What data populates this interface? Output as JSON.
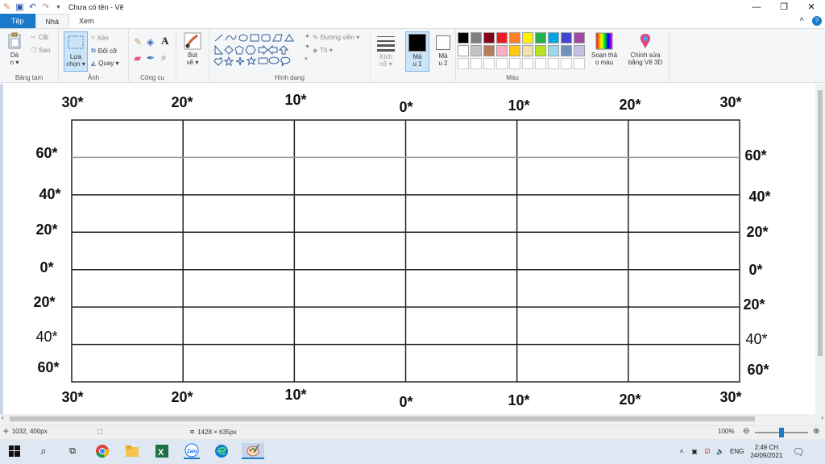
{
  "window": {
    "title": "Chưa có tên - Vẽ",
    "min_glyph": "—",
    "max_glyph": "❐",
    "close_glyph": "✕"
  },
  "tabs": [
    {
      "label": "Tệp"
    },
    {
      "label": "Nhà"
    },
    {
      "label": "Xem"
    }
  ],
  "ribbon": {
    "clipboard": {
      "paste_label": "Dá",
      "paste_label2": "n ▾",
      "cut_label": "Cắt",
      "copy_label": "Sao",
      "group_label": "Bảng tạm"
    },
    "image": {
      "select_label": "Lựa",
      "select_label2": "chọn ▾",
      "crop_label": "Xén",
      "resize_label": "Đổi cỡ",
      "rotate_label": "Quay ▾",
      "group_label": "Ảnh"
    },
    "tools": {
      "group_label": "Công cụ"
    },
    "brush": {
      "label": "Bút",
      "label2": "vẽ ▾"
    },
    "shapes": {
      "outline_label": "Đường viền ▾",
      "fill_label": "Tô ▾",
      "group_label": "Hình dạng"
    },
    "size": {
      "label": "Kích",
      "label2": "cỡ ▾"
    },
    "color1": {
      "label": "Mà",
      "label2": "u 1",
      "value": "#000000"
    },
    "color2": {
      "label": "Mà",
      "label2": "u 2",
      "value": "#ffffff"
    },
    "palette": {
      "colors": [
        "#000000",
        "#7f7f7f",
        "#880015",
        "#ed1c24",
        "#ff7f27",
        "#fff200",
        "#22b14c",
        "#00a2e8",
        "#3f48cc",
        "#a349a4",
        "#ffffff",
        "#c3c3c3",
        "#b97a57",
        "#ffaec9",
        "#ffc90e",
        "#efe4b0",
        "#b5e61d",
        "#99d9ea",
        "#7092be",
        "#c8bfe7"
      ],
      "group_label": "Màu"
    },
    "edit_colors": {
      "label": "Soạn thả",
      "label2": "o màu"
    },
    "paint3d": {
      "label": "Chỉnh sửa",
      "label2": "bằng Vẽ 3D"
    }
  },
  "canvas": {
    "top_labels": [
      "30*",
      "20*",
      "10*",
      "0*",
      "10*",
      "20*",
      "30*"
    ],
    "bottom_labels": [
      "30*",
      "20*",
      "10*",
      "0*",
      "10*",
      "20*",
      "30*"
    ],
    "left_labels": [
      "60*",
      "40*",
      "20*",
      "0*",
      "20*",
      "40*",
      "60*"
    ],
    "right_labels": [
      "60*",
      "40*",
      "20*",
      "0*",
      "20*",
      "40*",
      "60*"
    ]
  },
  "status": {
    "cursor_pos": "1032, 400px",
    "image_size": "1428 × 635px",
    "zoom": "100%",
    "zoom_fraction": 0.5
  },
  "taskbar": {
    "lang": "ENG",
    "time": "2:49 CH",
    "date": "24/09/2021"
  }
}
